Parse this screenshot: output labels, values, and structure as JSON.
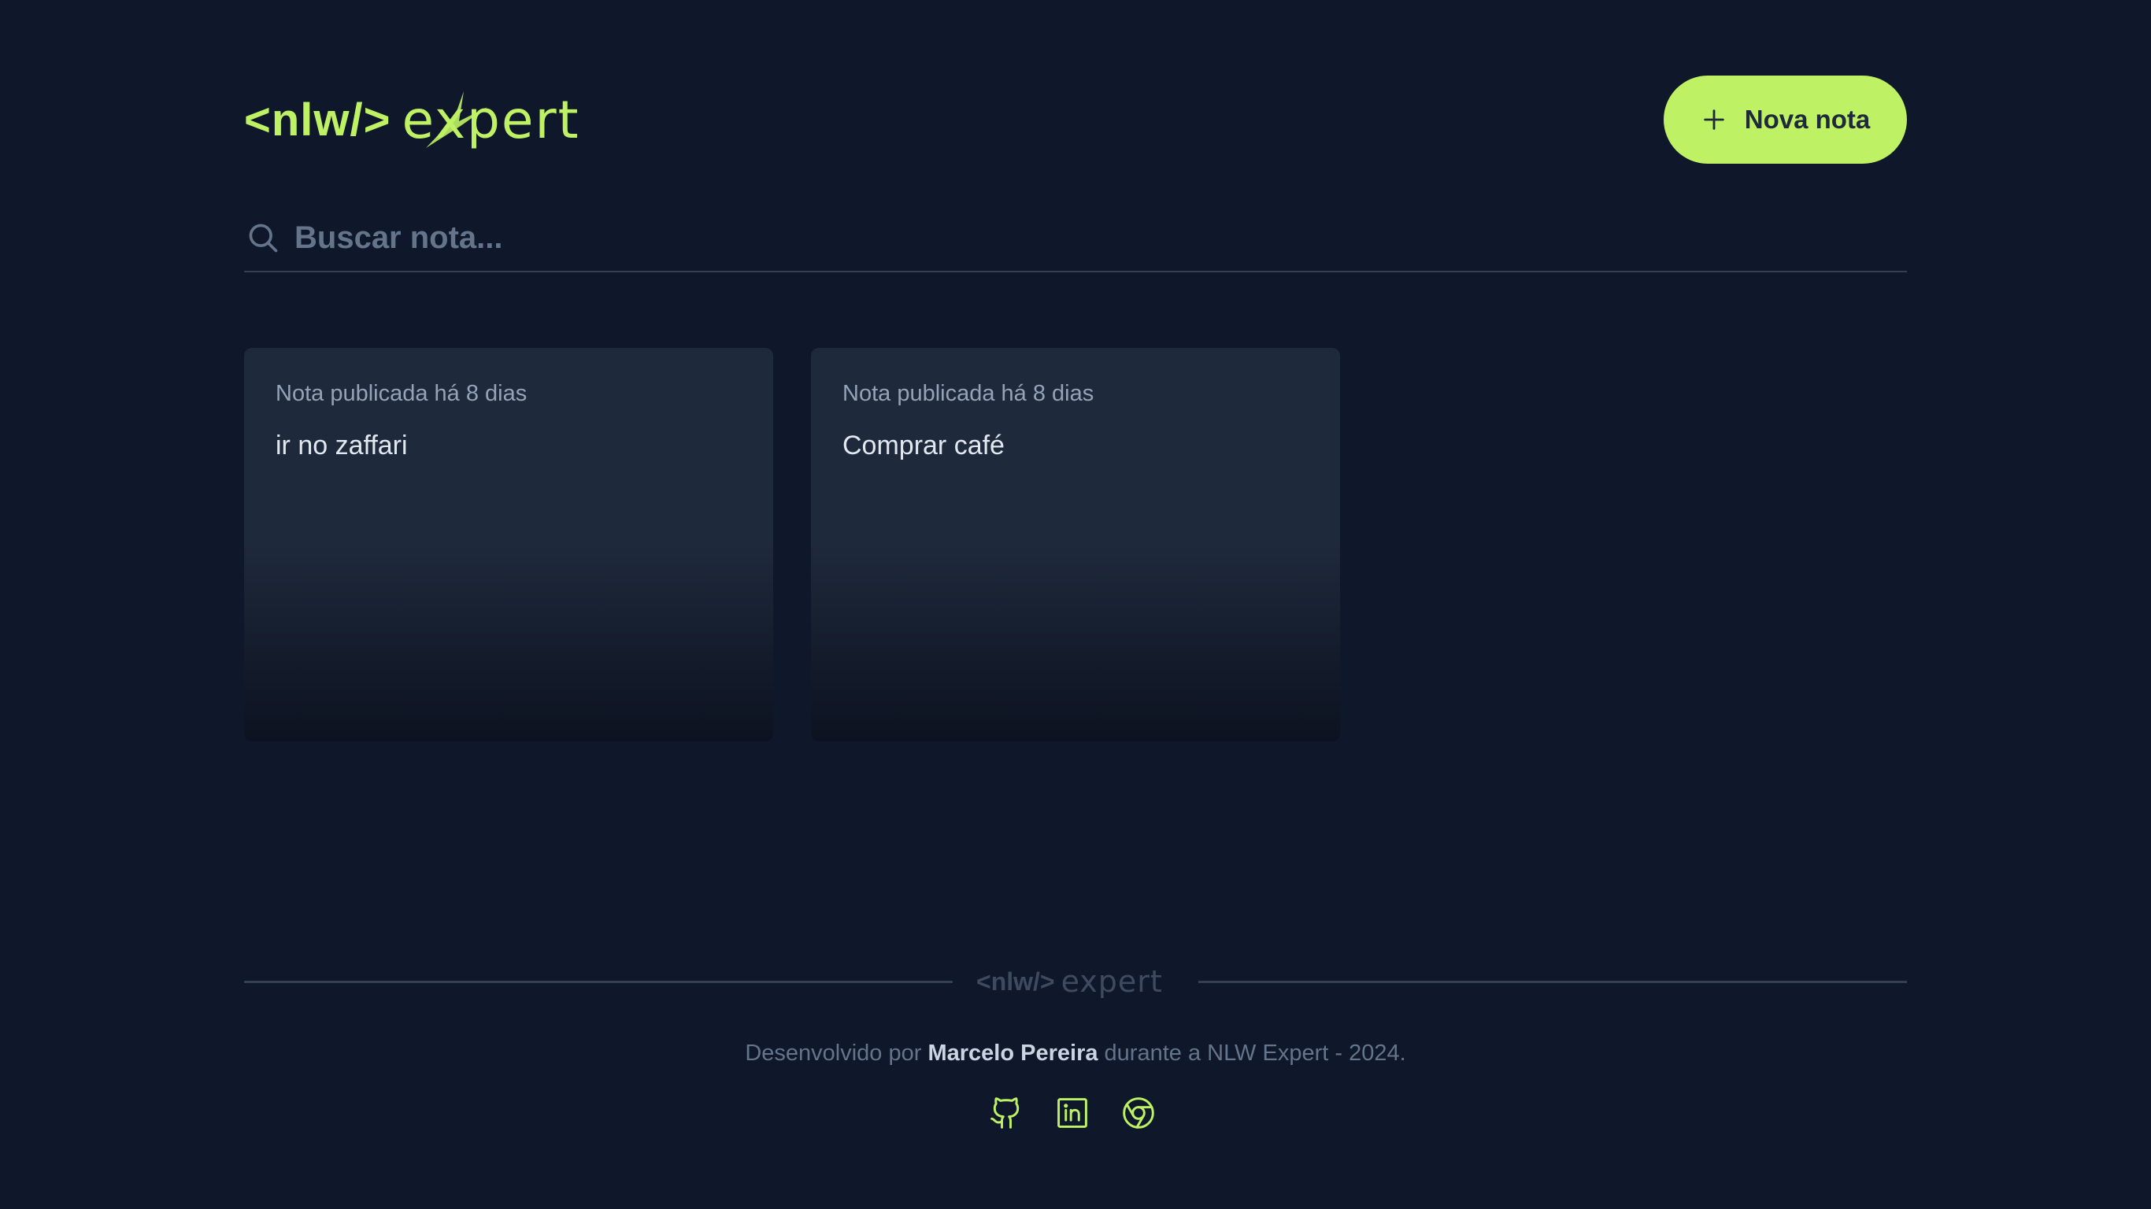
{
  "colors": {
    "background": "#0f172a",
    "accent": "#bef264",
    "card": "#1e293b",
    "muted_text": "#94a3b8",
    "text": "#e2e8f0"
  },
  "header": {
    "logo_prefix": "<nlw/>",
    "logo_word": "expert",
    "new_note_label": "Nova nota",
    "new_note_icon": "plus-icon"
  },
  "search": {
    "placeholder": "Buscar nota...",
    "value": "",
    "icon": "search-icon"
  },
  "notes": [
    {
      "meta": "Nota publicada há 8 dias",
      "content": "ir no zaffari"
    },
    {
      "meta": "Nota publicada há 8 dias",
      "content": "Comprar café"
    }
  ],
  "footer": {
    "logo_prefix": "<nlw/>",
    "logo_word": "expert",
    "text_before": "Desenvolvido por ",
    "author": "Marcelo Pereira",
    "text_after": " durante a NLW Expert - 2024.",
    "socials": [
      {
        "icon": "github-icon"
      },
      {
        "icon": "linkedin-icon"
      },
      {
        "icon": "chrome-icon"
      }
    ]
  }
}
